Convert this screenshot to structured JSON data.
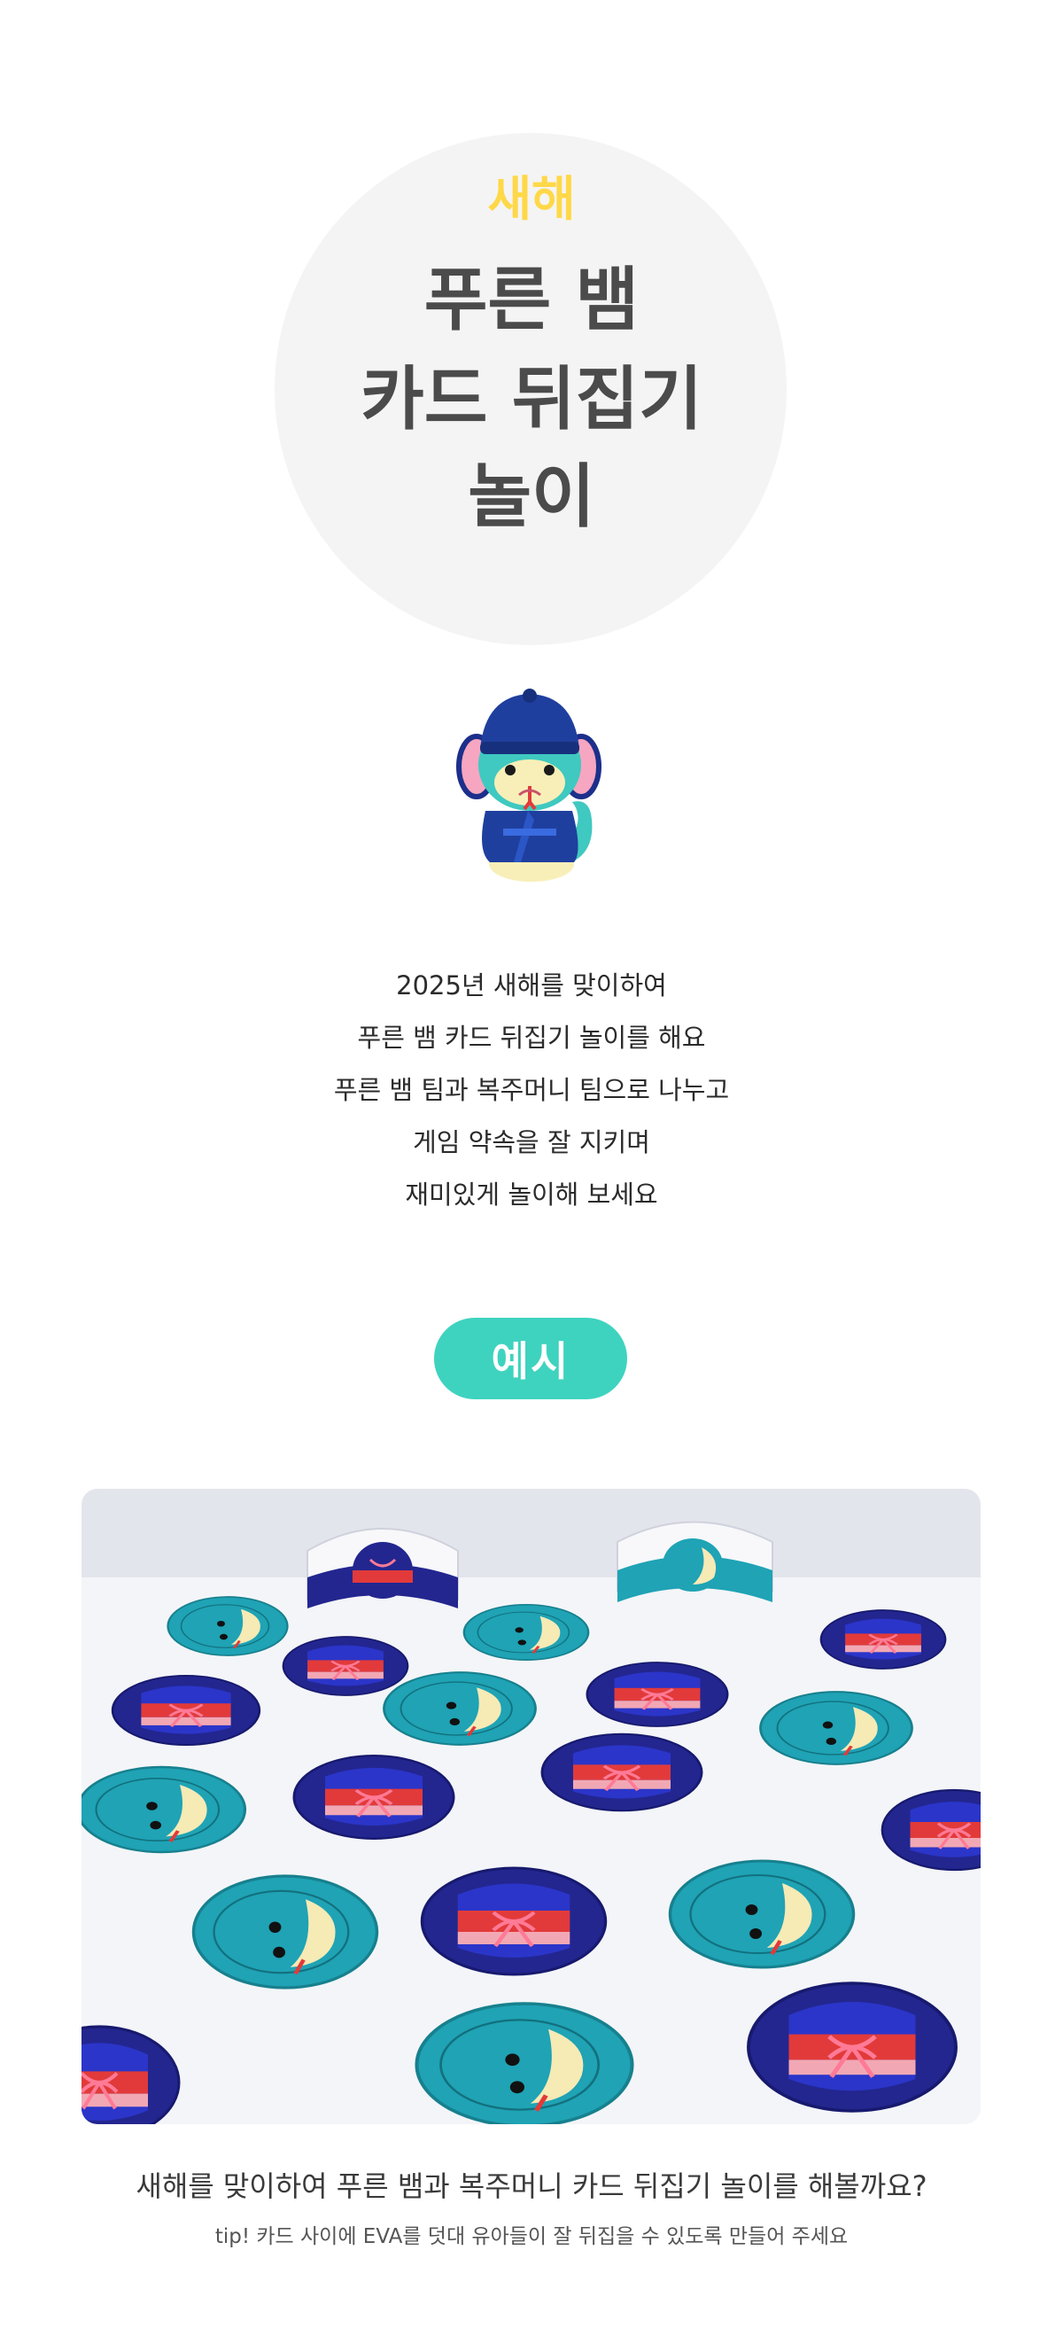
{
  "header": {
    "kicker": "새해",
    "title_lines": [
      "푸른 뱀",
      "카드 뒤집기",
      "놀이"
    ]
  },
  "description": {
    "lines": [
      "2025년 새해를 맞이하여",
      "푸른 뱀 카드 뒤집기 놀이를 해요",
      "푸른 뱀 팀과 복주머니 팀으로 나누고",
      "게임 약속을 잘 지키며",
      "재미있게 놀이해 보세요"
    ]
  },
  "example": {
    "badge_label": "예시"
  },
  "photo": {
    "caption": "새해를 맞이하여 푸른 뱀과 복주머니 카드 뒤집기 놀이를 해볼까요?",
    "tip": "tip! 카드 사이에 EVA를 덧대 유아들이 잘 뒤집을 수 있도록 만들어 주세요"
  },
  "colors": {
    "kicker": "#ffd848",
    "title": "#4b4b4b",
    "badge": "#3ed3bf",
    "snake_card": "#1fa3b5",
    "pouch_card": "#23268f"
  }
}
